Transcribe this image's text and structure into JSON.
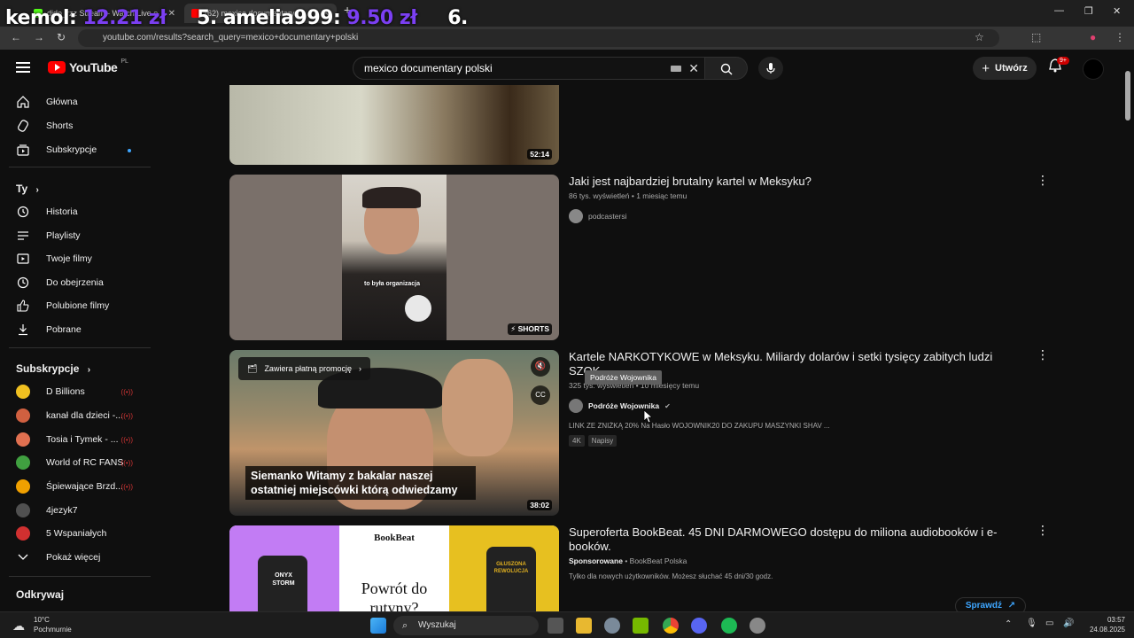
{
  "browser": {
    "tabs": [
      {
        "label": "dido_rzz Stream - Watch Live o"
      },
      {
        "label": "(62) mexico documentary"
      }
    ],
    "url": "youtube.com/results?search_query=mexico+documentary+polski"
  },
  "overlay": {
    "entries": [
      {
        "name": "kemol:",
        "amount": "12.21 zł"
      },
      {
        "name": "5. amelia999:",
        "amount": "9.50 zł"
      },
      {
        "name": "6.",
        "amount": ""
      }
    ]
  },
  "header": {
    "logo_text": "YouTube",
    "country": "PL",
    "search_value": "mexico documentary polski",
    "create_label": "Utwórz",
    "notifications_badge": "9+"
  },
  "sidebar": {
    "main": [
      {
        "label": "Główna",
        "icon": "home-icon"
      },
      {
        "label": "Shorts",
        "icon": "shorts-icon"
      },
      {
        "label": "Subskrypcje",
        "icon": "subscriptions-icon"
      }
    ],
    "you_heading": "Ty",
    "you": [
      {
        "label": "Historia",
        "icon": "history-icon"
      },
      {
        "label": "Playlisty",
        "icon": "playlist-icon"
      },
      {
        "label": "Twoje filmy",
        "icon": "your-videos-icon"
      },
      {
        "label": "Do obejrzenia",
        "icon": "watch-later-icon"
      },
      {
        "label": "Polubione filmy",
        "icon": "liked-icon"
      },
      {
        "label": "Pobrane",
        "icon": "download-icon"
      }
    ],
    "subs_heading": "Subskrypcje",
    "subscriptions": [
      {
        "label": "D Billions",
        "color": "#f0c020",
        "live": true
      },
      {
        "label": "kanał dla dzieci -...",
        "color": "#d06040",
        "live": true
      },
      {
        "label": "Tosia i Tymek - ...",
        "color": "#e07050",
        "live": true
      },
      {
        "label": "World of RC FANS",
        "color": "#40a040",
        "live": true
      },
      {
        "label": "Śpiewające Brzd...",
        "color": "#f0a000",
        "live": true
      },
      {
        "label": "4jezyk7",
        "color": "#505050",
        "live": false
      },
      {
        "label": "5 Wspaniałych",
        "color": "#d03030",
        "live": false
      }
    ],
    "show_more": "Pokaż więcej",
    "explore_heading": "Odkrywaj"
  },
  "results": [
    {
      "duration": "52:14"
    },
    {
      "title": "Jaki jest najbardziej brutalny kartel w Meksyku?",
      "meta": "86 tys. wyświetleń • 1 miesiąc temu",
      "channel": "podcastersi",
      "badge": "SHORTS",
      "caption": "to była organizacja"
    },
    {
      "title": "Kartele NARKOTYKOWE w Meksyku. Miliardy dolarów i setki tysięcy zabitych ludzi SZOK",
      "meta": "325 tys. wyświetleń • 10 miesięcy temu",
      "channel": "Podróże Wojownika",
      "description": "LINK ZE ZNIŻKĄ 20% Na Hasło WOJOWNIK20 DO ZAKUPU MASZYNKI SHAV ...",
      "tags": [
        "4K",
        "Napisy"
      ],
      "duration": "38:02",
      "promo": "Zawiera płatną promocję",
      "subtitle": "Siemanko Witamy z bakalar naszej ostatniej miejscówki którą odwiedzamy",
      "tooltip": "Podróże Wojownika"
    },
    {
      "title": "Superoferta BookBeat. 45 DNI DARMOWEGO dostępu do miliona audiobooków i e-booków.",
      "sponsored": "Sponsorowane",
      "advertiser": "BookBeat Polska",
      "description": "Tylko dla nowych użytkowników. Możesz słuchać 45 dni/30 godz.",
      "cta": "Sprawdź",
      "ad_brand": "BookBeat",
      "ad_headline": "Powrót do rutyny?",
      "ad_book_left": "ONYX STORM",
      "ad_book_right": "GŁUSZONA REWOLUCJA"
    }
  ],
  "taskbar": {
    "weather_temp": "10°C",
    "weather_desc": "Pochmurnie",
    "search": "Wyszukaj",
    "time": "03:57",
    "date": "24.08.2025"
  }
}
